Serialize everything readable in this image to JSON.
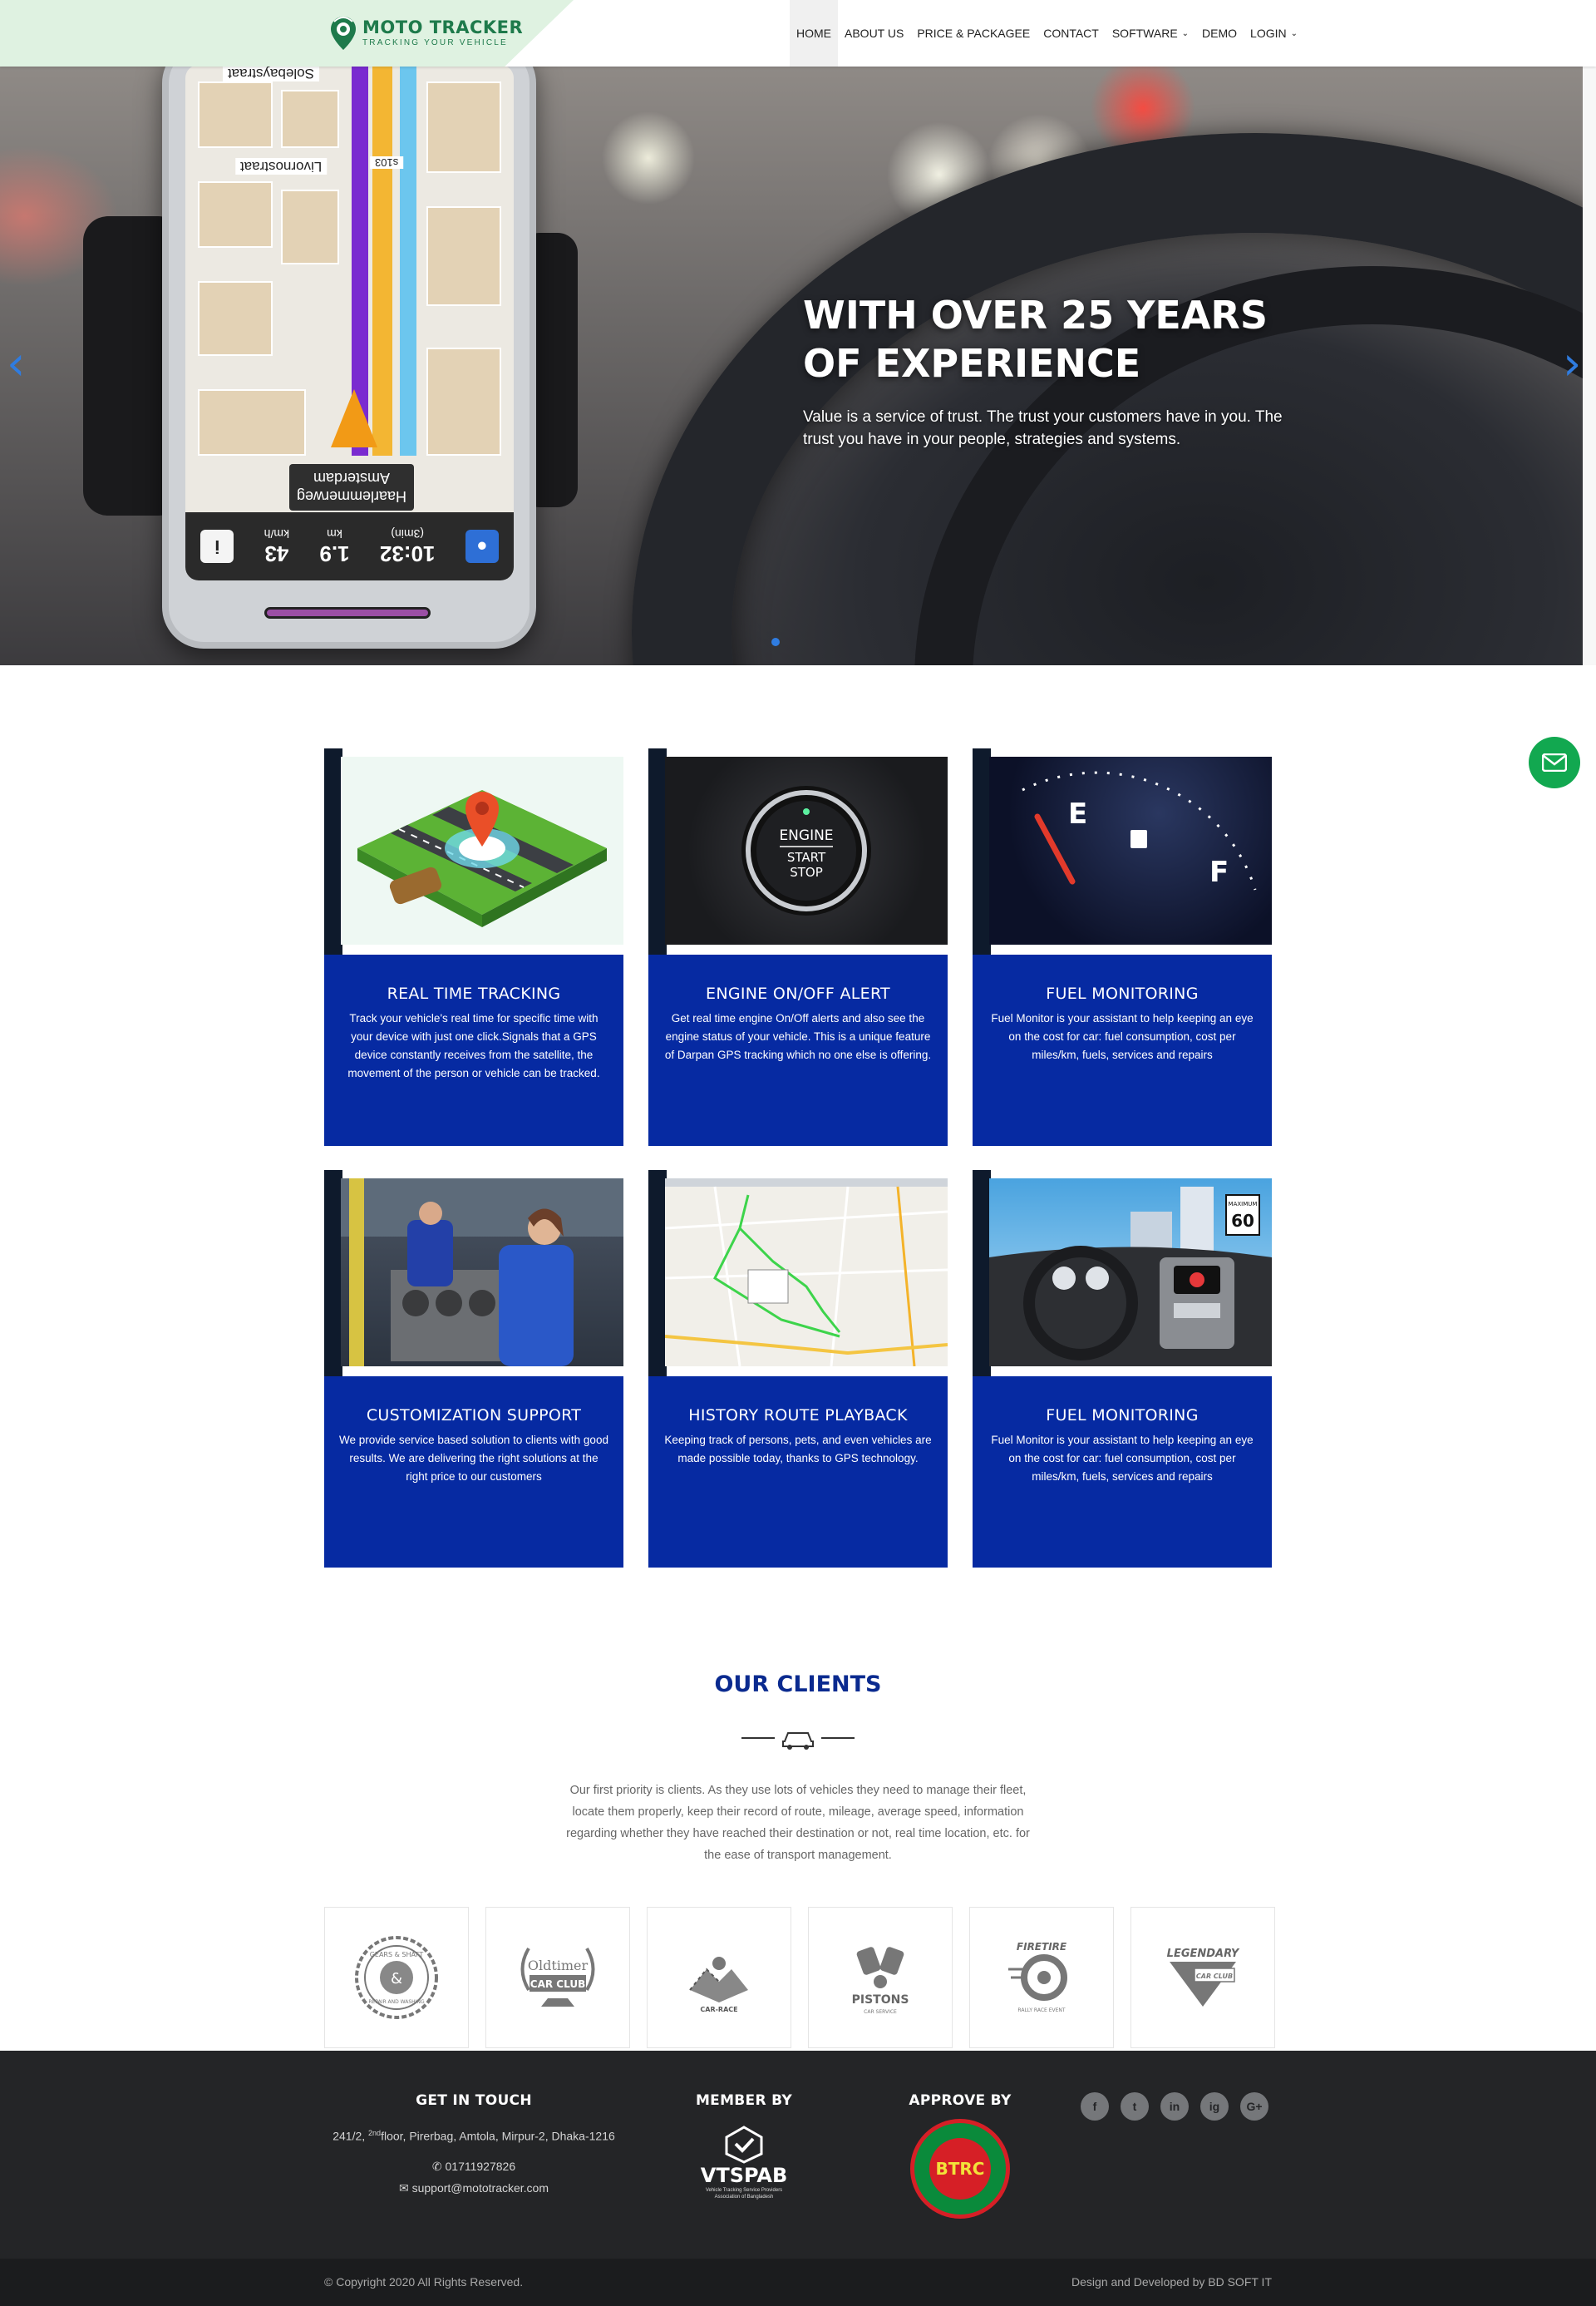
{
  "brand": {
    "name": "MOTO TRACKER",
    "tagline": "TRACKING YOUR VEHICLE",
    "accent": "#1e7a4b",
    "primary_blue": "#062aa2"
  },
  "nav": {
    "items": [
      {
        "label": "HOME",
        "active": true
      },
      {
        "label": "ABOUT US"
      },
      {
        "label": "PRICE & PACKAGEE"
      },
      {
        "label": "CONTACT"
      },
      {
        "label": "SOFTWARE",
        "dropdown": true
      },
      {
        "label": "DEMO"
      },
      {
        "label": "LOGIN",
        "dropdown": true
      }
    ]
  },
  "hero": {
    "title": "WITH OVER 25 YEARS OF EXPERIENCE",
    "subtitle": "Value is a service of trust. The trust your customers have in you. The trust you have in your people, strategies and systems.",
    "phone": {
      "street1": "Solebaystraat",
      "street2": "Livornostraat",
      "road_no": "s103",
      "destination": "Haarlemmerweg Amsterdam",
      "speed": "43",
      "speed_unit": "km/h",
      "distance": "1.9",
      "distance_unit": "km",
      "time": "10:32",
      "time_sub": "(3min)"
    }
  },
  "features": [
    {
      "title": "REAL TIME TRACKING",
      "text": "Track your vehicle's real time for specific time with your device with just one click.Signals that a GPS device constantly receives from the satellite, the movement of the person or vehicle can be tracked."
    },
    {
      "title": "ENGINE ON/OFF ALERT",
      "text": "Get real time engine On/Off alerts and also see the engine status of your vehicle. This is a unique feature of Darpan GPS tracking which no one else is offering."
    },
    {
      "title": "FUEL MONITORING",
      "text": "Fuel Monitor is your assistant to help keeping an eye on the cost for car: fuel consumption, cost per miles/km, fuels, services and repairs"
    },
    {
      "title": "CUSTOMIZATION SUPPORT",
      "text": "We provide service based solution to clients with good results. We are delivering the right solutions at the right price to our customers"
    },
    {
      "title": "HISTORY ROUTE PLAYBACK",
      "text": "Keeping track of persons, pets, and even vehicles are made possible today, thanks to GPS technology."
    },
    {
      "title": "FUEL MONITORING",
      "text": "Fuel Monitor is your assistant to help keeping an eye on the cost for car: fuel consumption, cost per miles/km, fuels, services and repairs"
    }
  ],
  "feature_images": {
    "engine": {
      "line1": "ENGINE",
      "line2": "START",
      "line3": "STOP"
    },
    "gauge": {
      "e": "E",
      "f": "F"
    },
    "speed_sign": {
      "label": "MAXIMUM",
      "value": "60"
    }
  },
  "clients": {
    "title": "OUR CLIENTS",
    "text": "Our first priority is clients. As they use lots of vehicles they need to manage their fleet, locate them properly, keep their record of route, mileage, average speed, information regarding whether they have reached their destination or not, real time location, etc. for the ease of transport management.",
    "logos": [
      {
        "top": "GEARS & SHAFT",
        "mid": "&",
        "bottom": "REPAIR AND WASHING"
      },
      {
        "top": "Oldtimer",
        "mid": "CAR CLUB",
        "bottom": ""
      },
      {
        "top": "",
        "mid": "CAR-RACE",
        "bottom": ""
      },
      {
        "top": "",
        "mid": "PISTONS",
        "bottom": "CAR SERVICE"
      },
      {
        "top": "FIRETIRE",
        "mid": "",
        "bottom": "RALLY RACE EVENT"
      },
      {
        "top": "LEGENDARY",
        "mid": "CAR CLUB",
        "bottom": ""
      }
    ]
  },
  "footer": {
    "contact": {
      "heading": "GET IN TOUCH",
      "address_pre": "241/2, ",
      "address_sup": "2nd",
      "address_post": "floor, Pirerbag, Amtola, Mirpur-2, Dhaka-1216",
      "phone": "01711927826",
      "email": "support@mototracker.com"
    },
    "member": {
      "heading": "MEMBER BY",
      "logo_text": "VTSPAB",
      "logo_sub": "Vehicle Tracking Service Providers Association of Bangladesh"
    },
    "approve": {
      "heading": "APPROVE BY",
      "logo_text": "BTRC"
    },
    "social_icons": [
      "facebook-icon",
      "twitter-icon",
      "linkedin-icon",
      "instagram-icon",
      "google-plus-icon"
    ],
    "social_glyphs": [
      "f",
      "t",
      "in",
      "ig",
      "G+"
    ],
    "copyright": "© Copyright 2020 All Rights Reserved.",
    "credit": "Design and Developed by BD SOFT IT"
  }
}
